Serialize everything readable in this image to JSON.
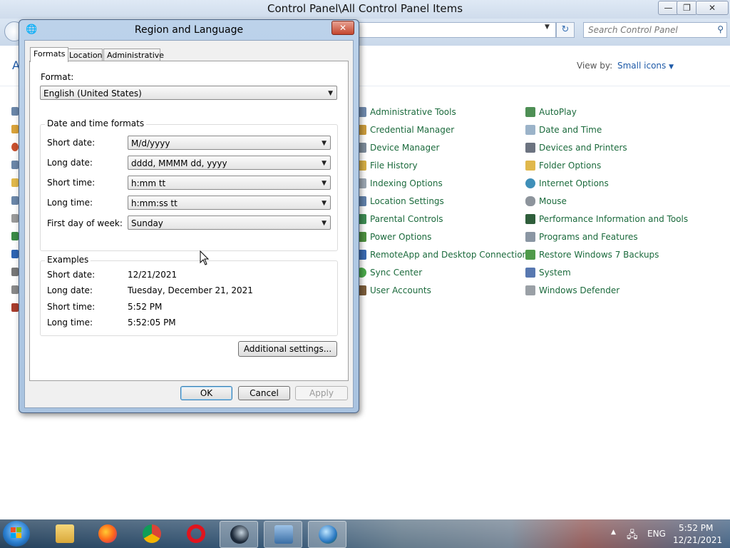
{
  "window": {
    "title": "Control Panel\\All Control Panel Items",
    "search_placeholder": "Search Control Panel",
    "header_fragment": "A",
    "view_by_label": "View by:",
    "view_by_value": "Small icons"
  },
  "control_panel_items": {
    "column1": [
      "Administrative Tools",
      "Credential Manager",
      "Device Manager",
      "File History",
      "Indexing Options",
      "Location Settings",
      "Parental Controls",
      "Power Options",
      "RemoteApp and Desktop Connections",
      "Sync Center",
      "User Accounts"
    ],
    "column2": [
      "AutoPlay",
      "Date and Time",
      "Devices and Printers",
      "Folder Options",
      "Internet Options",
      "Mouse",
      "Performance Information and Tools",
      "Programs and Features",
      "Restore Windows 7 Backups",
      "System",
      "Windows Defender"
    ]
  },
  "dialog": {
    "title": "Region and Language",
    "tabs": [
      "Formats",
      "Location",
      "Administrative"
    ],
    "format_label": "Format:",
    "format_value": "English (United States)",
    "date_time_group_title": "Date and time formats",
    "fields": [
      {
        "label": "Short date:",
        "value": "M/d/yyyy"
      },
      {
        "label": "Long date:",
        "value": "dddd, MMMM dd, yyyy"
      },
      {
        "label": "Short time:",
        "value": "h:mm tt"
      },
      {
        "label": "Long time:",
        "value": "h:mm:ss tt"
      },
      {
        "label": "First day of week:",
        "value": "Sunday"
      }
    ],
    "examples_title": "Examples",
    "examples": [
      {
        "label": "Short date:",
        "value": "12/21/2021"
      },
      {
        "label": "Long date:",
        "value": "Tuesday, December 21, 2021"
      },
      {
        "label": "Short time:",
        "value": "5:52 PM"
      },
      {
        "label": "Long time:",
        "value": "5:52:05 PM"
      }
    ],
    "additional_settings": "Additional settings...",
    "ok": "OK",
    "cancel": "Cancel",
    "apply": "Apply"
  },
  "taskbar": {
    "language": "ENG",
    "time": "5:52 PM",
    "date": "12/21/2021"
  }
}
